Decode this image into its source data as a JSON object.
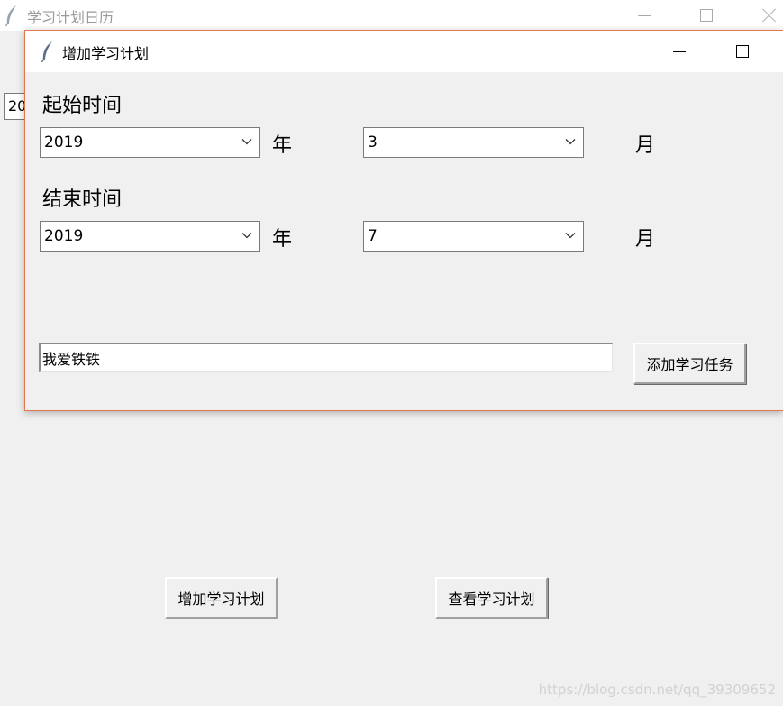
{
  "main_window": {
    "title": "学习计划日历",
    "partial_year_combo": "20",
    "add_plan_button": "增加学习计划",
    "view_plan_button": "查看学习计划",
    "watermark": "https://blog.csdn.net/qq_39309652"
  },
  "dialog": {
    "title": "增加学习计划",
    "start": {
      "label": "起始时间",
      "year": "2019",
      "year_unit": "年",
      "month": "3",
      "month_unit": "月"
    },
    "end": {
      "label": "结束时间",
      "year": "2019",
      "year_unit": "年",
      "month": "7",
      "month_unit": "月"
    },
    "task_entry_value": "我爱铁铁",
    "add_task_button": "添加学习任务"
  },
  "icons": {
    "app": "feather-icon",
    "minimize": "minimize-icon",
    "maximize": "maximize-icon",
    "close": "close-icon",
    "dropdown": "chevron-down-icon"
  },
  "colors": {
    "window_bg": "#f0f0f0",
    "titlebar_bg": "#ffffff",
    "dialog_border": "#e0794f",
    "inactive_title": "#9a9a9a"
  }
}
